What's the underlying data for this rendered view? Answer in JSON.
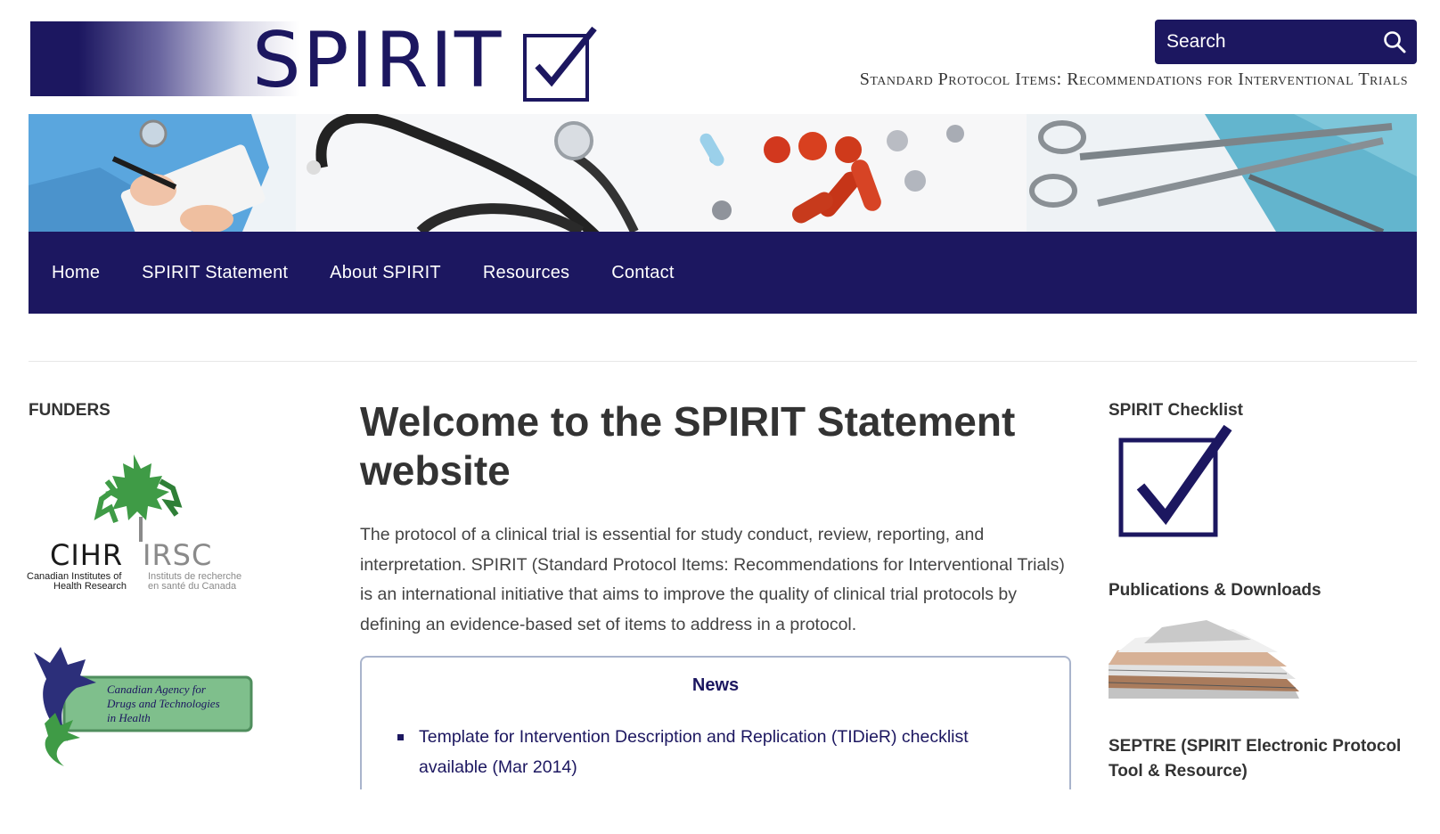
{
  "header": {
    "logo_text": "SPIRIT",
    "tagline": "Standard Protocol Items: Recommendations for Interventional Trials",
    "search": {
      "placeholder": "Search",
      "icon": "search-icon"
    }
  },
  "banner": {
    "images": [
      "clinician-writing-image",
      "stethoscope-image",
      "pills-image",
      "surgical-scissors-image"
    ]
  },
  "nav": {
    "items": [
      {
        "label": "Home"
      },
      {
        "label": "SPIRIT Statement"
      },
      {
        "label": "About SPIRIT"
      },
      {
        "label": "Resources"
      },
      {
        "label": "Contact"
      }
    ]
  },
  "left": {
    "funders_heading": "FUNDERS",
    "cihr": {
      "abbr_en": "CIHR",
      "abbr_fr": "IRSC",
      "name_en": "Canadian Institutes of Health Research",
      "name_fr": "Instituts de recherche en santé du Canada"
    },
    "cadth": {
      "name": "Canadian Agency for Drugs and Technologies in Health"
    }
  },
  "main": {
    "title": "Welcome to the SPIRIT Statement website",
    "intro": "The protocol of a clinical trial is essential for study conduct, review, reporting, and interpretation. SPIRIT (Standard Protocol Items: Recommendations for Interventional Trials) is an international initiative that aims to improve the quality of clinical trial protocols by defining an evidence-based set of items to address in a protocol.",
    "news": {
      "title": "News",
      "items": [
        {
          "text": "Template for Intervention Description and Replication (TIDieR) checklist available (Mar 2014)"
        }
      ]
    }
  },
  "right": {
    "checklist_heading": "SPIRIT Checklist",
    "publications_heading": "Publications & Downloads",
    "septre_heading": "SEPTRE (SPIRIT Electronic Protocol Tool & Resource)"
  },
  "colors": {
    "brand": "#1c1760",
    "text": "#333333",
    "news_border": "#a9b4cc"
  }
}
